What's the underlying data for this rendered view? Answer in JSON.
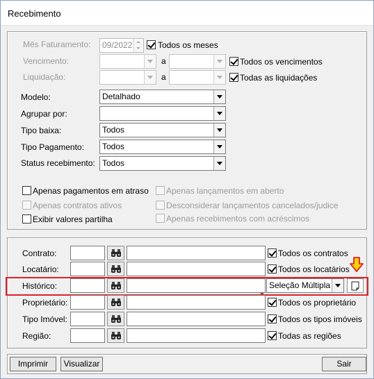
{
  "window": {
    "title": "Recebimento"
  },
  "filters": {
    "mes_faturamento": {
      "label": "Mês Faturamento:",
      "value": "09/2022",
      "check_label": "Todos os meses",
      "checked": true
    },
    "vencimento": {
      "label": "Vencimento:",
      "sep": "a",
      "check_label": "Todos os vencimentos",
      "checked": true
    },
    "liquidacao": {
      "label": "Liquidação:",
      "sep": "a",
      "check_label": "Todas as liquidações",
      "checked": true
    },
    "modelo": {
      "label": "Modelo:",
      "value": "Detalhado"
    },
    "agrupar": {
      "label": "Agrupar por:",
      "value": ""
    },
    "tipo_baixa": {
      "label": "Tipo baixa:",
      "value": "Todos"
    },
    "tipo_pagamento": {
      "label": "Tipo Pagamento:",
      "value": "Todos"
    },
    "status_recebimento": {
      "label": "Status recebimento:",
      "value": "Todos"
    }
  },
  "options": {
    "atraso": "Apenas pagamentos em atraso",
    "contratos_ativos": "Apenas contratos ativos",
    "partilha": "Exibir valores partilha",
    "lancamentos_aberto": "Apenas lançamentos em aberto",
    "desconsiderar": "Desconsiderar lançamentos cancelados/judice",
    "acrescimos": "Apenas recebimentos com acréscimos"
  },
  "entities": {
    "contrato": {
      "label": "Contrato:",
      "check_label": "Todos os contratos"
    },
    "locatario": {
      "label": "Locatário:",
      "check_label": "Todos os locatários"
    },
    "historico": {
      "label": "Histórico:",
      "select_value": "Seleção Múltipla"
    },
    "proprietario": {
      "label": "Proprietário:",
      "check_label": "Todos os proprietário"
    },
    "tipo_imovel": {
      "label": "Tipo Imóvel:",
      "check_label": "Todos os tipos imóveis"
    },
    "regiao": {
      "label": "Região:",
      "check_label": "Todas as regiões"
    }
  },
  "buttons": {
    "imprimir": "Imprimir",
    "visualizar": "Visualizar",
    "sair": "Sair"
  },
  "colors": {
    "highlight": "#e0202a",
    "arrow": "#f5d400"
  }
}
